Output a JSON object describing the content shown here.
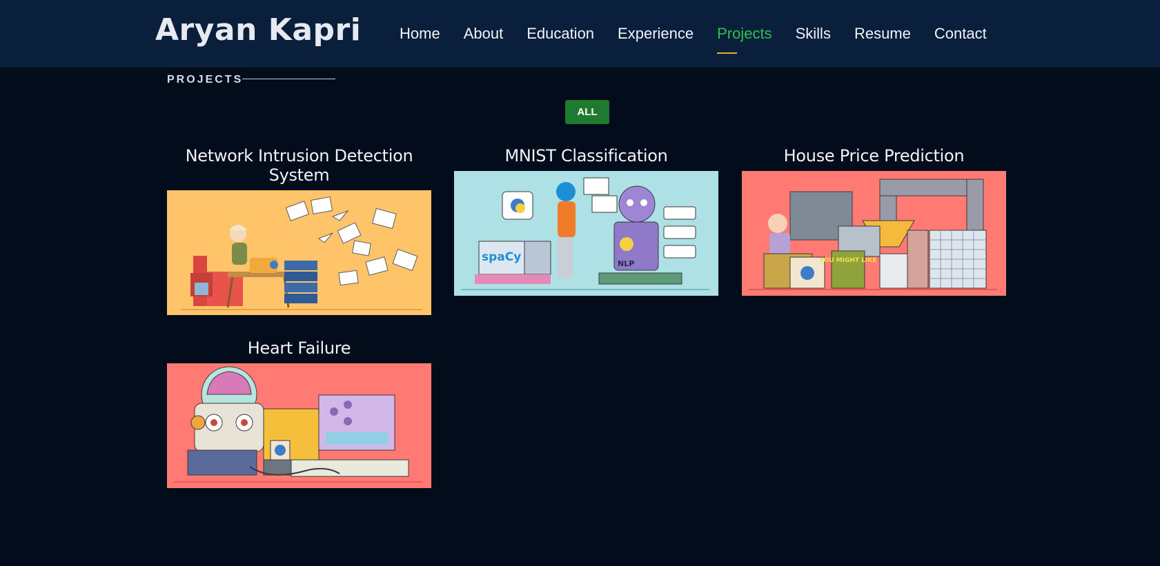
{
  "header": {
    "brand": "Aryan Kapri",
    "nav": [
      {
        "label": "Home"
      },
      {
        "label": "About"
      },
      {
        "label": "Education"
      },
      {
        "label": "Experience"
      },
      {
        "label": "Projects",
        "active": true
      },
      {
        "label": "Skills"
      },
      {
        "label": "Resume"
      },
      {
        "label": "Contact"
      }
    ]
  },
  "section": {
    "title": "PROJECTS",
    "filter_label": "ALL"
  },
  "projects": [
    {
      "title": "Network Intrusion Detection System",
      "image_bg": "#ffc36a"
    },
    {
      "title": "MNIST Classification",
      "image_bg": "#aee1e6",
      "image_text": "spaCy",
      "image_text_2": "NLP"
    },
    {
      "title": "House Price Prediction",
      "image_bg": "#ff7a73",
      "image_text": "YOU MIGHT LIKE"
    },
    {
      "title": "Heart Failure",
      "image_bg": "#ff7a73"
    }
  ],
  "colors": {
    "page_bg": "#020c1b",
    "header_bg": "#0a1f3c",
    "accent_green": "#2ec24b",
    "accent_gold": "#e6b127",
    "button_green": "#1e7a2e"
  }
}
